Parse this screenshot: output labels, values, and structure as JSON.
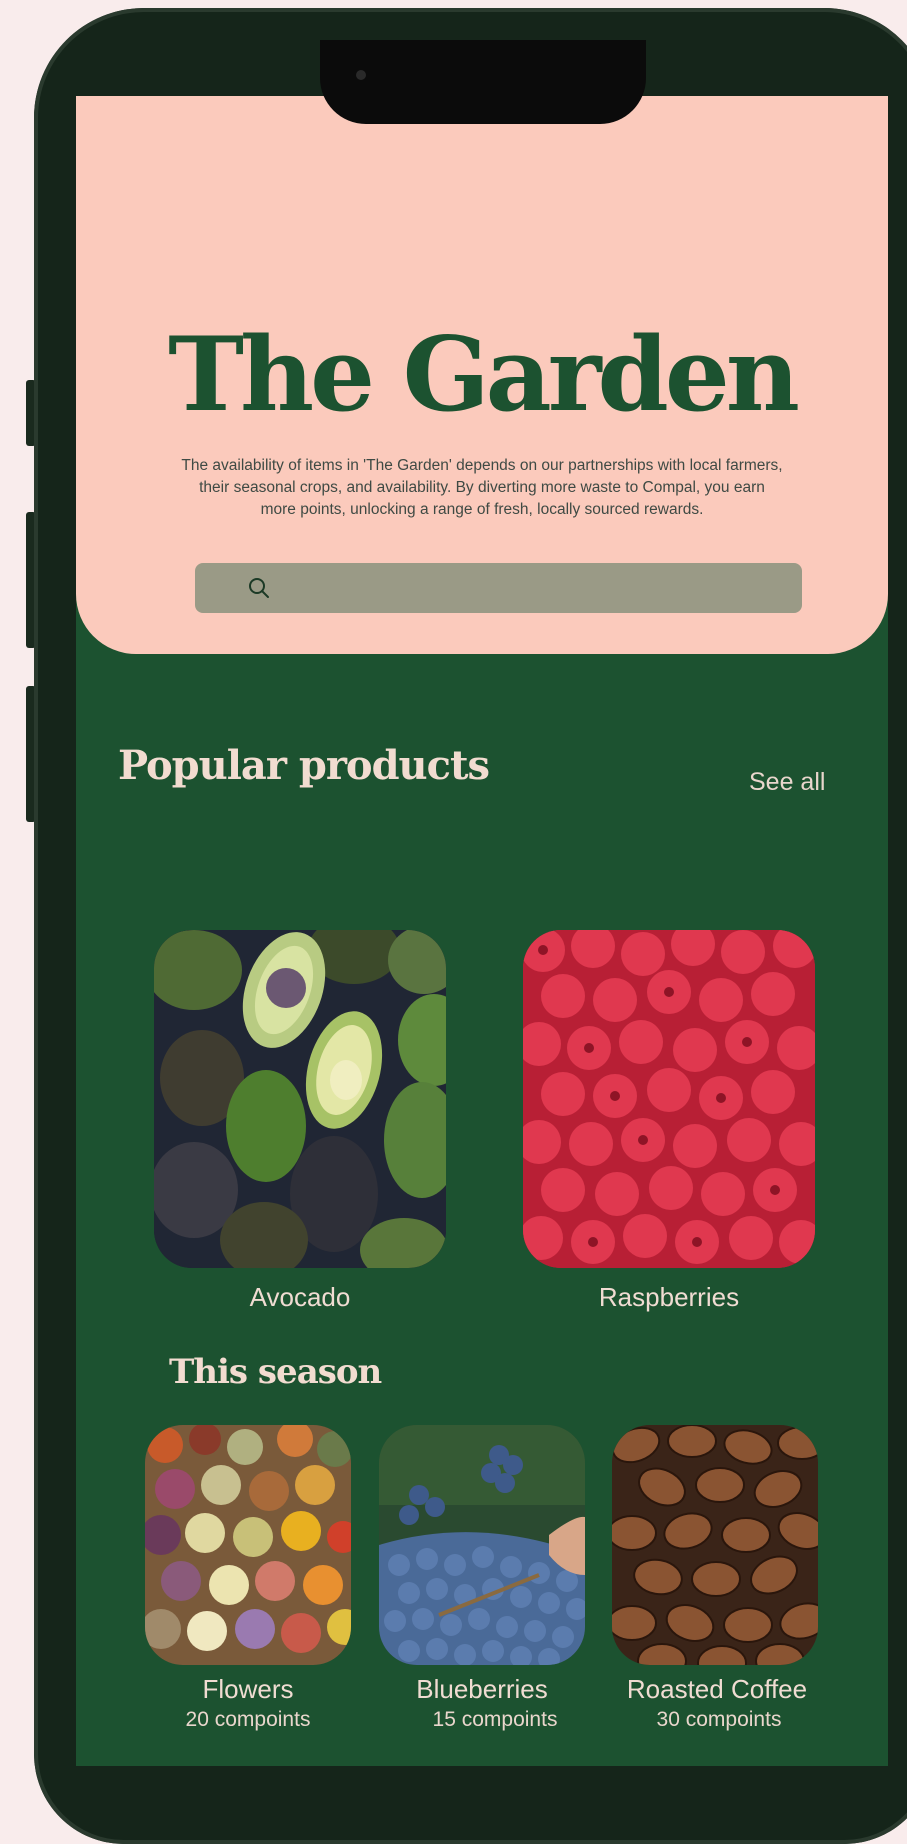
{
  "header": {
    "title": "The Garden",
    "description": "The availability of items in 'The Garden' depends on our partnerships with local farmers, their seasonal crops, and availability. By diverting more waste to Compal, you earn more points, unlocking a range of fresh, locally sourced rewards.",
    "search_placeholder": ""
  },
  "popular": {
    "title": "Popular products",
    "see_all": "See all",
    "items": [
      {
        "label": "Avocado",
        "image": "avocado-photo"
      },
      {
        "label": "Raspberries",
        "image": "raspberries-photo"
      }
    ]
  },
  "season": {
    "title": "This season",
    "items": [
      {
        "label": "Flowers",
        "points": "20 compoints",
        "image": "flowers-photo"
      },
      {
        "label": "Blueberries",
        "points": "15 compoints",
        "image": "blueberries-photo"
      },
      {
        "label": "Roasted Coffee",
        "points": "30 compoints",
        "image": "coffee-beans-photo"
      }
    ]
  },
  "colors": {
    "brand_green": "#1c5230",
    "hero_peach": "#fbcabc",
    "search_bg": "#9a9a86",
    "text_light": "#f2dcd0"
  }
}
